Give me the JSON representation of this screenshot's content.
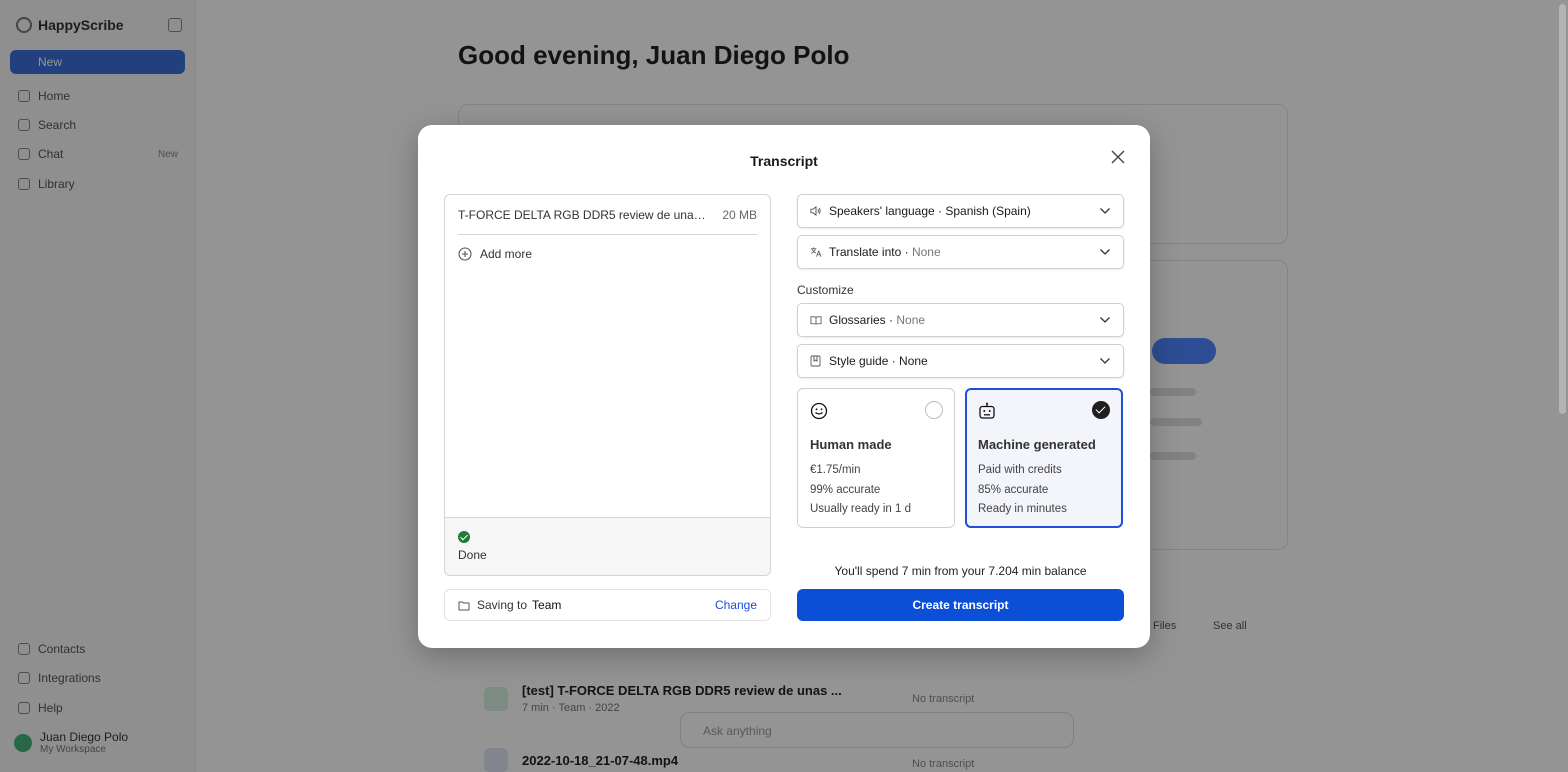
{
  "background": {
    "app_name": "HappyScribe",
    "new_label": "New",
    "nav": [
      {
        "label": "Home",
        "badge": ""
      },
      {
        "label": "Search",
        "badge": ""
      },
      {
        "label": "Chat",
        "badge": "New"
      },
      {
        "label": "Library",
        "badge": ""
      }
    ],
    "bottom_nav": [
      "Contacts",
      "Integrations",
      "Help"
    ],
    "user_name": "Juan Diego Polo",
    "user_sub": "My Workspace",
    "greeting": "Good evening, Juan Diego Polo",
    "recent": [
      {
        "title": "[test] T-FORCE DELTA RGB DDR5 review de unas ...",
        "meta": "7 min · Team · 2022",
        "status": "No transcript"
      },
      {
        "title": "2022-10-18_21-07-48.mp4",
        "meta": "",
        "status": "No transcript"
      }
    ],
    "ask_placeholder": "Ask anything",
    "see_all_label": "See all",
    "files_label": "Files"
  },
  "modal": {
    "title": "Transcript",
    "file": {
      "name": "T-FORCE DELTA RGB DDR5 review de unas ...",
      "size": "20 MB"
    },
    "add_more": "Add more",
    "status": "Done",
    "saving_label": "Saving to",
    "saving_target": "Team",
    "change_label": "Change",
    "speakers_language": {
      "label": "Speakers' language · Spanish (Spain)"
    },
    "translate": {
      "label": "Translate into ·",
      "value": "None"
    },
    "customize_label": "Customize",
    "glossaries": {
      "label": "Glossaries ·",
      "value": "None"
    },
    "style_guide": {
      "label": "Style guide · None"
    },
    "options": {
      "human": {
        "title": "Human made",
        "line1": "€1.75/min",
        "line2": "99% accurate",
        "line3": "Usually ready in 1 d",
        "selected": false
      },
      "machine": {
        "title": "Machine generated",
        "line1": "Paid with credits",
        "line2": "85% accurate",
        "line3": "Ready in minutes",
        "selected": true
      }
    },
    "spend_text": "You'll spend 7 min from your 7.204 min balance",
    "create_button": "Create transcript"
  },
  "colors": {
    "accent": "#0a4fd6",
    "success": "#1e7a3b",
    "overlay": "rgba(0,0,0,0.42)"
  }
}
